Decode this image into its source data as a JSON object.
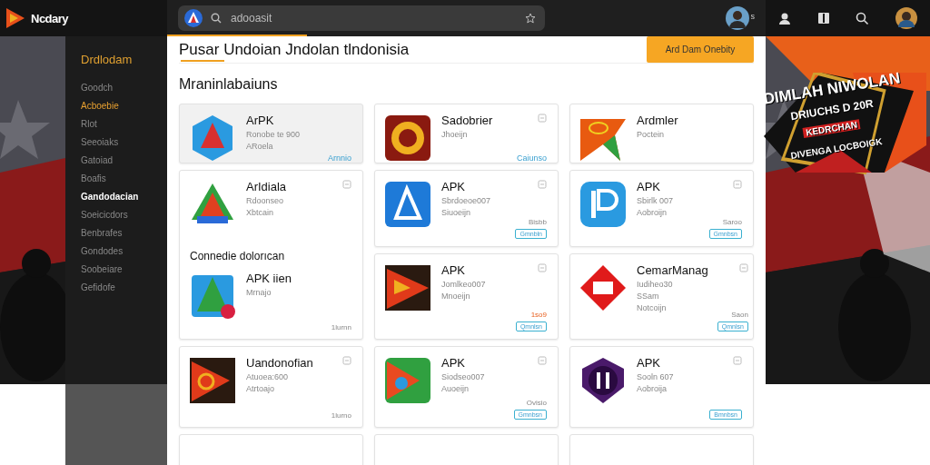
{
  "brand": {
    "name": "Ncdary"
  },
  "search": {
    "value": "adooasit"
  },
  "top_right": {
    "badge": "s"
  },
  "sidebar": {
    "title": "Drdlodam",
    "items": [
      {
        "label": "Goodch",
        "selected": false,
        "highlighted": false
      },
      {
        "label": "Acboebie",
        "selected": true,
        "highlighted": false
      },
      {
        "label": "Rlot",
        "selected": false,
        "highlighted": false
      },
      {
        "label": "Seeoiaks",
        "selected": false,
        "highlighted": false
      },
      {
        "label": "Gatoiad",
        "selected": false,
        "highlighted": false
      },
      {
        "label": "Boafis",
        "selected": false,
        "highlighted": false
      },
      {
        "label": "Gandodacian",
        "selected": false,
        "highlighted": true
      },
      {
        "label": "Soeicicdors",
        "selected": false,
        "highlighted": false
      },
      {
        "label": "Benbrafes",
        "selected": false,
        "highlighted": false
      },
      {
        "label": "Gondodes",
        "selected": false,
        "highlighted": false
      },
      {
        "label": "Soobeiare",
        "selected": false,
        "highlighted": false
      },
      {
        "label": "Gefidofe",
        "selected": false,
        "highlighted": false
      }
    ]
  },
  "header": {
    "title": "Pusar Undoian Jndolan tlndonisia",
    "button": "Ard Dam Onebity"
  },
  "section": {
    "title": "Mraninlabaiuns"
  },
  "columns": [
    [
      {
        "kind": "app",
        "selected": true,
        "name": "ArPK",
        "lines": [
          "Ronobe te 900",
          "ARoela"
        ],
        "action": {
          "kind": "link",
          "label": "Arnnio"
        }
      },
      {
        "kind": "group",
        "items": [
          {
            "name": "ArIdiala",
            "lines": [
              "Rdoonseo",
              "Xbtcain"
            ],
            "bookmark": true
          }
        ],
        "heading": "Connedie dolorıcan",
        "more": [
          {
            "name": "APK iien",
            "lines": [
              "Mrnajo"
            ],
            "side": "1lurnn"
          }
        ]
      },
      {
        "kind": "app",
        "selected": false,
        "name": "Uandonofian",
        "lines": [
          "Atuoea:600",
          "Atrtoajo"
        ],
        "side": "1lurno",
        "bookmark": true
      },
      {
        "kind": "stub"
      }
    ],
    [
      {
        "kind": "app",
        "selected": false,
        "name": "Sadobrier",
        "lines": [
          "Jhoeijn"
        ],
        "bookmark": true,
        "action": {
          "kind": "link",
          "label": "Caiunso"
        }
      },
      {
        "kind": "app",
        "selected": false,
        "name": "APK",
        "lines": [
          "Sbrdoeoe007",
          "Siuoeijn"
        ],
        "side": "Bisbb",
        "bookmark": true,
        "action": {
          "kind": "chip",
          "label": "Gmnbln"
        }
      },
      {
        "kind": "app",
        "selected": false,
        "name": "APK",
        "lines": [
          "Jomlkeo007",
          "Mnoeijn"
        ],
        "side": "1so9",
        "alert": true,
        "bookmark": true,
        "action": {
          "kind": "chip",
          "label": "Qmnlsn"
        }
      },
      {
        "kind": "app",
        "selected": false,
        "name": "APK",
        "lines": [
          "Siodseo007",
          "Auoeijn"
        ],
        "side": "Ovisio",
        "bookmark": true,
        "action": {
          "kind": "chip",
          "label": "Gmnbsn"
        }
      },
      {
        "kind": "stub"
      }
    ],
    [
      {
        "kind": "app",
        "selected": false,
        "name": "Ardmler",
        "lines": [
          "Poctein"
        ]
      },
      {
        "kind": "app",
        "selected": false,
        "name": "APK",
        "lines": [
          "Sbirlk 007",
          "Aobroijn"
        ],
        "side": "Saroo",
        "bookmark": true,
        "action": {
          "kind": "chip",
          "label": "Gmnbsn"
        }
      },
      {
        "kind": "app",
        "selected": false,
        "name": "CemarManag",
        "lines": [
          "Iudiheo30",
          "SSam",
          "Notcoijn"
        ],
        "side": "Saon",
        "bookmark": true,
        "action": {
          "kind": "chip",
          "label": "Qmnlsn"
        }
      },
      {
        "kind": "app",
        "selected": false,
        "name": "APK",
        "lines": [
          "Sooln 607",
          "Aobroija"
        ],
        "bookmark": true,
        "action": {
          "kind": "chip",
          "label": "Bmnbsn"
        }
      },
      {
        "kind": "stub"
      }
    ]
  ],
  "banner": {
    "lines": [
      "DIMLAH NIWOLAN",
      "DRIUCHS D 20R",
      "KEDRCHAN",
      "DIVENGA LOCBOIGK"
    ]
  }
}
